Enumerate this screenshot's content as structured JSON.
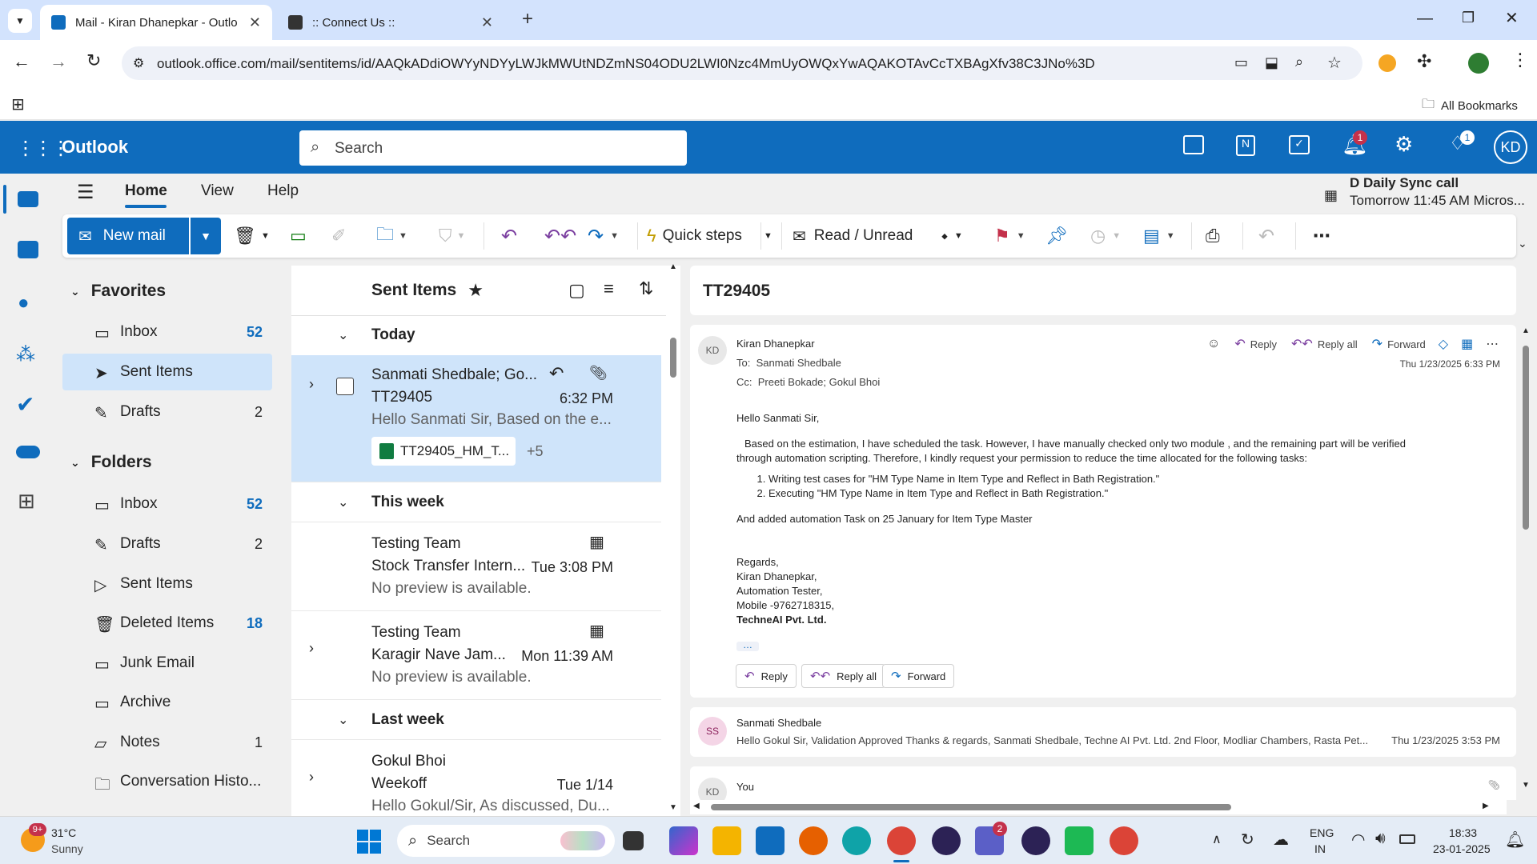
{
  "browser": {
    "tabs": [
      {
        "title": "Mail - Kiran Dhanepkar - Outlo"
      },
      {
        "title": ":: Connect Us ::"
      }
    ],
    "url": "outlook.office.com/mail/sentitems/id/AAQkADdiOWYyNDYyLWJkMWUtNDZmNS04ODU2LWI0Nzc4MmUyOWQxYwAQAKOTAvCcTXBAgXfv38C3JNo%3D",
    "bookmarks_label": "All Bookmarks"
  },
  "outlook": {
    "app_name": "Outlook",
    "search_placeholder": "Search",
    "notification_count": "1",
    "premium_count": "1",
    "avatar_initials": "KD"
  },
  "menu": {
    "tabs": [
      "Home",
      "View",
      "Help"
    ],
    "reminder": {
      "title": "D Daily Sync call",
      "time": "Tomorrow 11:45 AM Micros..."
    }
  },
  "ribbon": {
    "new_mail": "New mail",
    "quick_steps": "Quick steps",
    "read_unread": "Read / Unread"
  },
  "favorites": {
    "heading": "Favorites",
    "items": [
      {
        "label": "Inbox",
        "count": "52"
      },
      {
        "label": "Sent Items",
        "count": ""
      },
      {
        "label": "Drafts",
        "count": "2"
      }
    ]
  },
  "folders": {
    "heading": "Folders",
    "items": [
      {
        "label": "Inbox",
        "count": "52"
      },
      {
        "label": "Drafts",
        "count": "2"
      },
      {
        "label": "Sent Items",
        "count": ""
      },
      {
        "label": "Deleted Items",
        "count": "18"
      },
      {
        "label": "Junk Email",
        "count": ""
      },
      {
        "label": "Archive",
        "count": ""
      },
      {
        "label": "Notes",
        "count": "1"
      },
      {
        "label": "Conversation Histo...",
        "count": ""
      }
    ]
  },
  "message_list": {
    "title": "Sent Items",
    "groups": [
      "Today",
      "This week",
      "Last week"
    ],
    "messages": [
      {
        "from": "Sanmati Shedbale; Go...",
        "subject": "TT29405",
        "time": "6:32 PM",
        "preview": "Hello Sanmati Sir, Based on the e...",
        "attachment": "TT29405_HM_T...",
        "more": "+5"
      },
      {
        "from": "Testing Team",
        "subject": "Stock Transfer Intern...",
        "time": "Tue 3:08 PM",
        "preview": "No preview is available."
      },
      {
        "from": "Testing Team",
        "subject": "Karagir Nave Jam...",
        "time": "Mon 11:39 AM",
        "preview": "No preview is available."
      },
      {
        "from": "Gokul Bhoi",
        "subject": "Weekoff",
        "time": "Tue 1/14",
        "preview": "Hello Gokul/Sir, As discussed, Du..."
      }
    ]
  },
  "reading": {
    "subject": "TT29405",
    "sender_initials": "KD",
    "sender": "Kiran Dhanepkar",
    "to_label": "To:",
    "to": "Sanmati Shedbale",
    "cc_label": "Cc:",
    "cc": "Preeti Bokade;  Gokul Bhoi",
    "date": "Thu 1/23/2025 6:33 PM",
    "actions": {
      "reply": "Reply",
      "reply_all": "Reply all",
      "forward": "Forward"
    },
    "greeting": "Hello Sanmati Sir,",
    "para1_line1": "Based on the estimation, I have scheduled the task. However, I have manually checked only two module , and the remaining part will be verified",
    "para1_line2": "through automation scripting. Therefore, I kindly request your permission to reduce the time allocated for the following tasks:",
    "list": [
      "Writing test cases for \"HM Type Name in Item Type and Reflect in Bath Registration.\"",
      "Executing \"HM Type Name in Item Type and Reflect in Bath Registration.\""
    ],
    "para2": "And added automation Task on 25 January for Item Type Master",
    "sig": [
      "Regards,",
      "Kiran Dhanepkar,",
      "Automation Tester,",
      "Mobile -9762718315,"
    ],
    "company": "TechneAI Pvt. Ltd.",
    "ellipsis": "…",
    "thread": [
      {
        "initials": "SS",
        "sender": "Sanmati Shedbale",
        "preview": "Hello Gokul Sir, Validation Approved Thanks & regards, Sanmati Shedbale, Techne AI Pvt. Ltd. 2nd Floor, Modliar Chambers, Rasta Pet...",
        "date": "Thu 1/23/2025 3:53 PM"
      },
      {
        "initials": "KD",
        "sender": "You"
      }
    ]
  },
  "taskbar": {
    "weather_badge": "9+",
    "temp": "31°C",
    "condition": "Sunny",
    "search": "Search",
    "teams_badge": "2",
    "lang1": "ENG",
    "lang2": "IN",
    "time": "18:33",
    "date": "23-01-2025"
  },
  "colors": {
    "brand": "#0f6cbd",
    "selected": "#cfe4fa",
    "tabbar": "#d3e3fd"
  }
}
